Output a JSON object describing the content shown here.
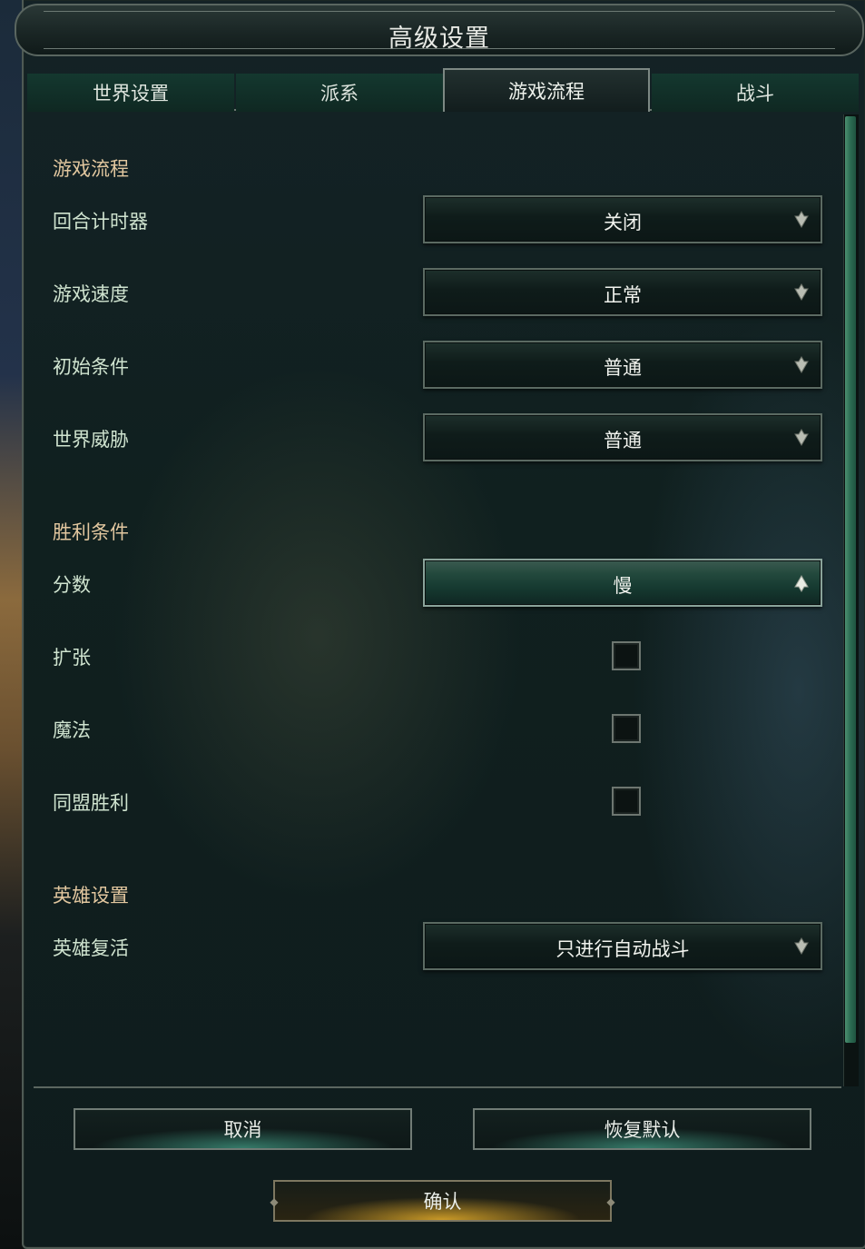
{
  "dialog": {
    "title": "高级设置"
  },
  "tabs": [
    {
      "label": "世界设置",
      "active": false
    },
    {
      "label": "派系",
      "active": false
    },
    {
      "label": "游戏流程",
      "active": true
    },
    {
      "label": "战斗",
      "active": false
    }
  ],
  "sections": {
    "game_flow": {
      "heading": "游戏流程",
      "turn_timer": {
        "label": "回合计时器",
        "value": "关闭"
      },
      "game_speed": {
        "label": "游戏速度",
        "value": "正常"
      },
      "start_conditions": {
        "label": "初始条件",
        "value": "普通"
      },
      "world_threat": {
        "label": "世界威胁",
        "value": "普通"
      }
    },
    "victory_conditions": {
      "heading": "胜利条件",
      "score": {
        "label": "分数",
        "value": "慢"
      },
      "expansion": {
        "label": "扩张",
        "checked": false
      },
      "magic": {
        "label": "魔法",
        "checked": false
      },
      "alliance_victory": {
        "label": "同盟胜利",
        "checked": false
      }
    },
    "hero_settings": {
      "heading": "英雄设置",
      "hero_revival": {
        "label": "英雄复活",
        "value": "只进行自动战斗"
      }
    }
  },
  "buttons": {
    "cancel": "取消",
    "restore_defaults": "恢复默认",
    "confirm": "确认"
  },
  "colors": {
    "heading": "#e2c79f",
    "label": "#cfe3cf",
    "accent_green": "#2b6b52",
    "accent_gold": "#d2a028"
  }
}
